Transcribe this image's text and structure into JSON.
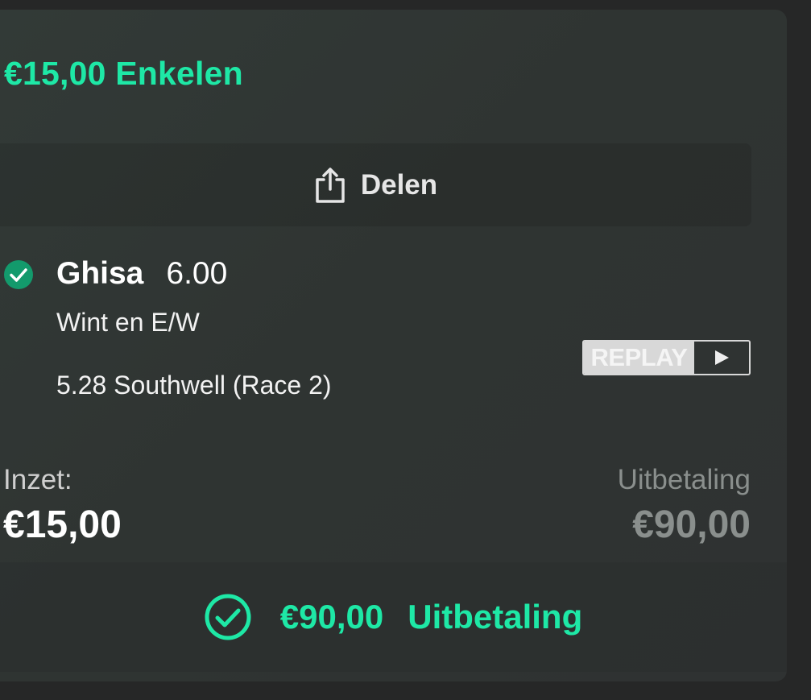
{
  "bet": {
    "title": "€15,00 Enkelen",
    "share_label": "Delen",
    "selection": {
      "name": "Ghisa",
      "odds": "6.00",
      "market": "Wint en E/W",
      "event": "5.28 Southwell (Race 2)",
      "status_icon": "check-circle-icon"
    },
    "replay_label": "REPLAY",
    "stake_label": "Inzet:",
    "stake_value": "€15,00",
    "payout_label": "Uitbetaling",
    "payout_value": "€90,00",
    "footer": {
      "amount": "€90,00",
      "label": "Uitbetaling"
    }
  },
  "colors": {
    "accent": "#1ee8a6",
    "check_fill": "#139a6c",
    "background": "#262727",
    "card": "#303534",
    "muted": "#8a8f8d"
  }
}
